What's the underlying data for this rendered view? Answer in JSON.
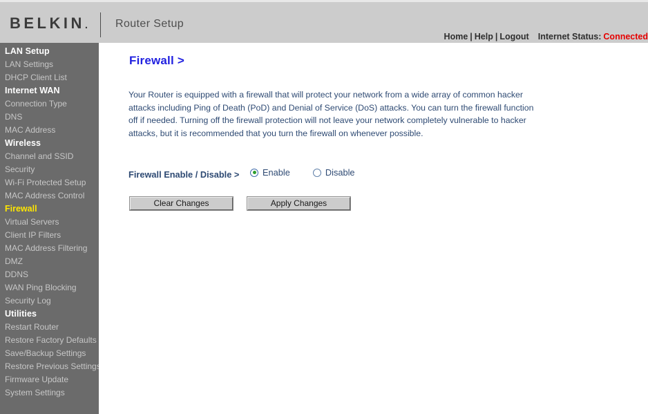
{
  "header": {
    "brand": "BELKIN",
    "brand_dot": ".",
    "app_title": "Router Setup",
    "nav": {
      "home": "Home",
      "help": "Help",
      "logout": "Logout",
      "separator": "|",
      "status_label": "Internet Status:",
      "status_value": "Connected"
    }
  },
  "sidebar": {
    "sections": [
      {
        "title": "LAN Setup",
        "items": [
          {
            "label": "LAN Settings",
            "active": false
          },
          {
            "label": "DHCP Client List",
            "active": false
          }
        ]
      },
      {
        "title": "Internet WAN",
        "items": [
          {
            "label": "Connection Type",
            "active": false
          },
          {
            "label": "DNS",
            "active": false
          },
          {
            "label": "MAC Address",
            "active": false
          }
        ]
      },
      {
        "title": "Wireless",
        "items": [
          {
            "label": "Channel and SSID",
            "active": false
          },
          {
            "label": "Security",
            "active": false
          },
          {
            "label": "Wi-Fi Protected Setup",
            "active": false
          },
          {
            "label": "MAC Address Control",
            "active": false
          },
          {
            "label": "Firewall",
            "active": true
          },
          {
            "label": "Virtual Servers",
            "active": false
          },
          {
            "label": "Client IP Filters",
            "active": false
          },
          {
            "label": "MAC Address Filtering",
            "active": false
          },
          {
            "label": "DMZ",
            "active": false
          },
          {
            "label": "DDNS",
            "active": false
          },
          {
            "label": "WAN Ping Blocking",
            "active": false
          },
          {
            "label": "Security Log",
            "active": false
          }
        ]
      },
      {
        "title": "Utilities",
        "items": [
          {
            "label": "Restart Router",
            "active": false
          },
          {
            "label": "Restore Factory Defaults",
            "active": false
          },
          {
            "label": "Save/Backup Settings",
            "active": false
          },
          {
            "label": "Restore Previous Settings",
            "active": false
          },
          {
            "label": "Firmware Update",
            "active": false
          },
          {
            "label": "System Settings",
            "active": false
          }
        ]
      }
    ]
  },
  "main": {
    "title": "Firewall >",
    "description": "Your Router is equipped with a firewall that will protect your network from a wide array of common hacker attacks including Ping of Death (PoD) and Denial of Service (DoS) attacks. You can turn the firewall function off if needed. Turning off the firewall protection will not leave your network completely vulnerable to hacker attacks, but it is recommended that you turn the firewall on whenever possible.",
    "setting": {
      "label": "Firewall Enable / Disable >",
      "options": [
        {
          "label": "Enable",
          "selected": true
        },
        {
          "label": "Disable",
          "selected": false
        }
      ]
    },
    "buttons": {
      "clear": "Clear Changes",
      "apply": "Apply Changes"
    }
  },
  "colors": {
    "header_bg": "#cccccc",
    "sidebar_bg": "#6b6b6b",
    "active_item": "#ffe600",
    "title_blue": "#2121e0",
    "body_blue": "#2e4a73",
    "status_red": "#e60000",
    "radio_dot_green": "#2e9e2e"
  }
}
